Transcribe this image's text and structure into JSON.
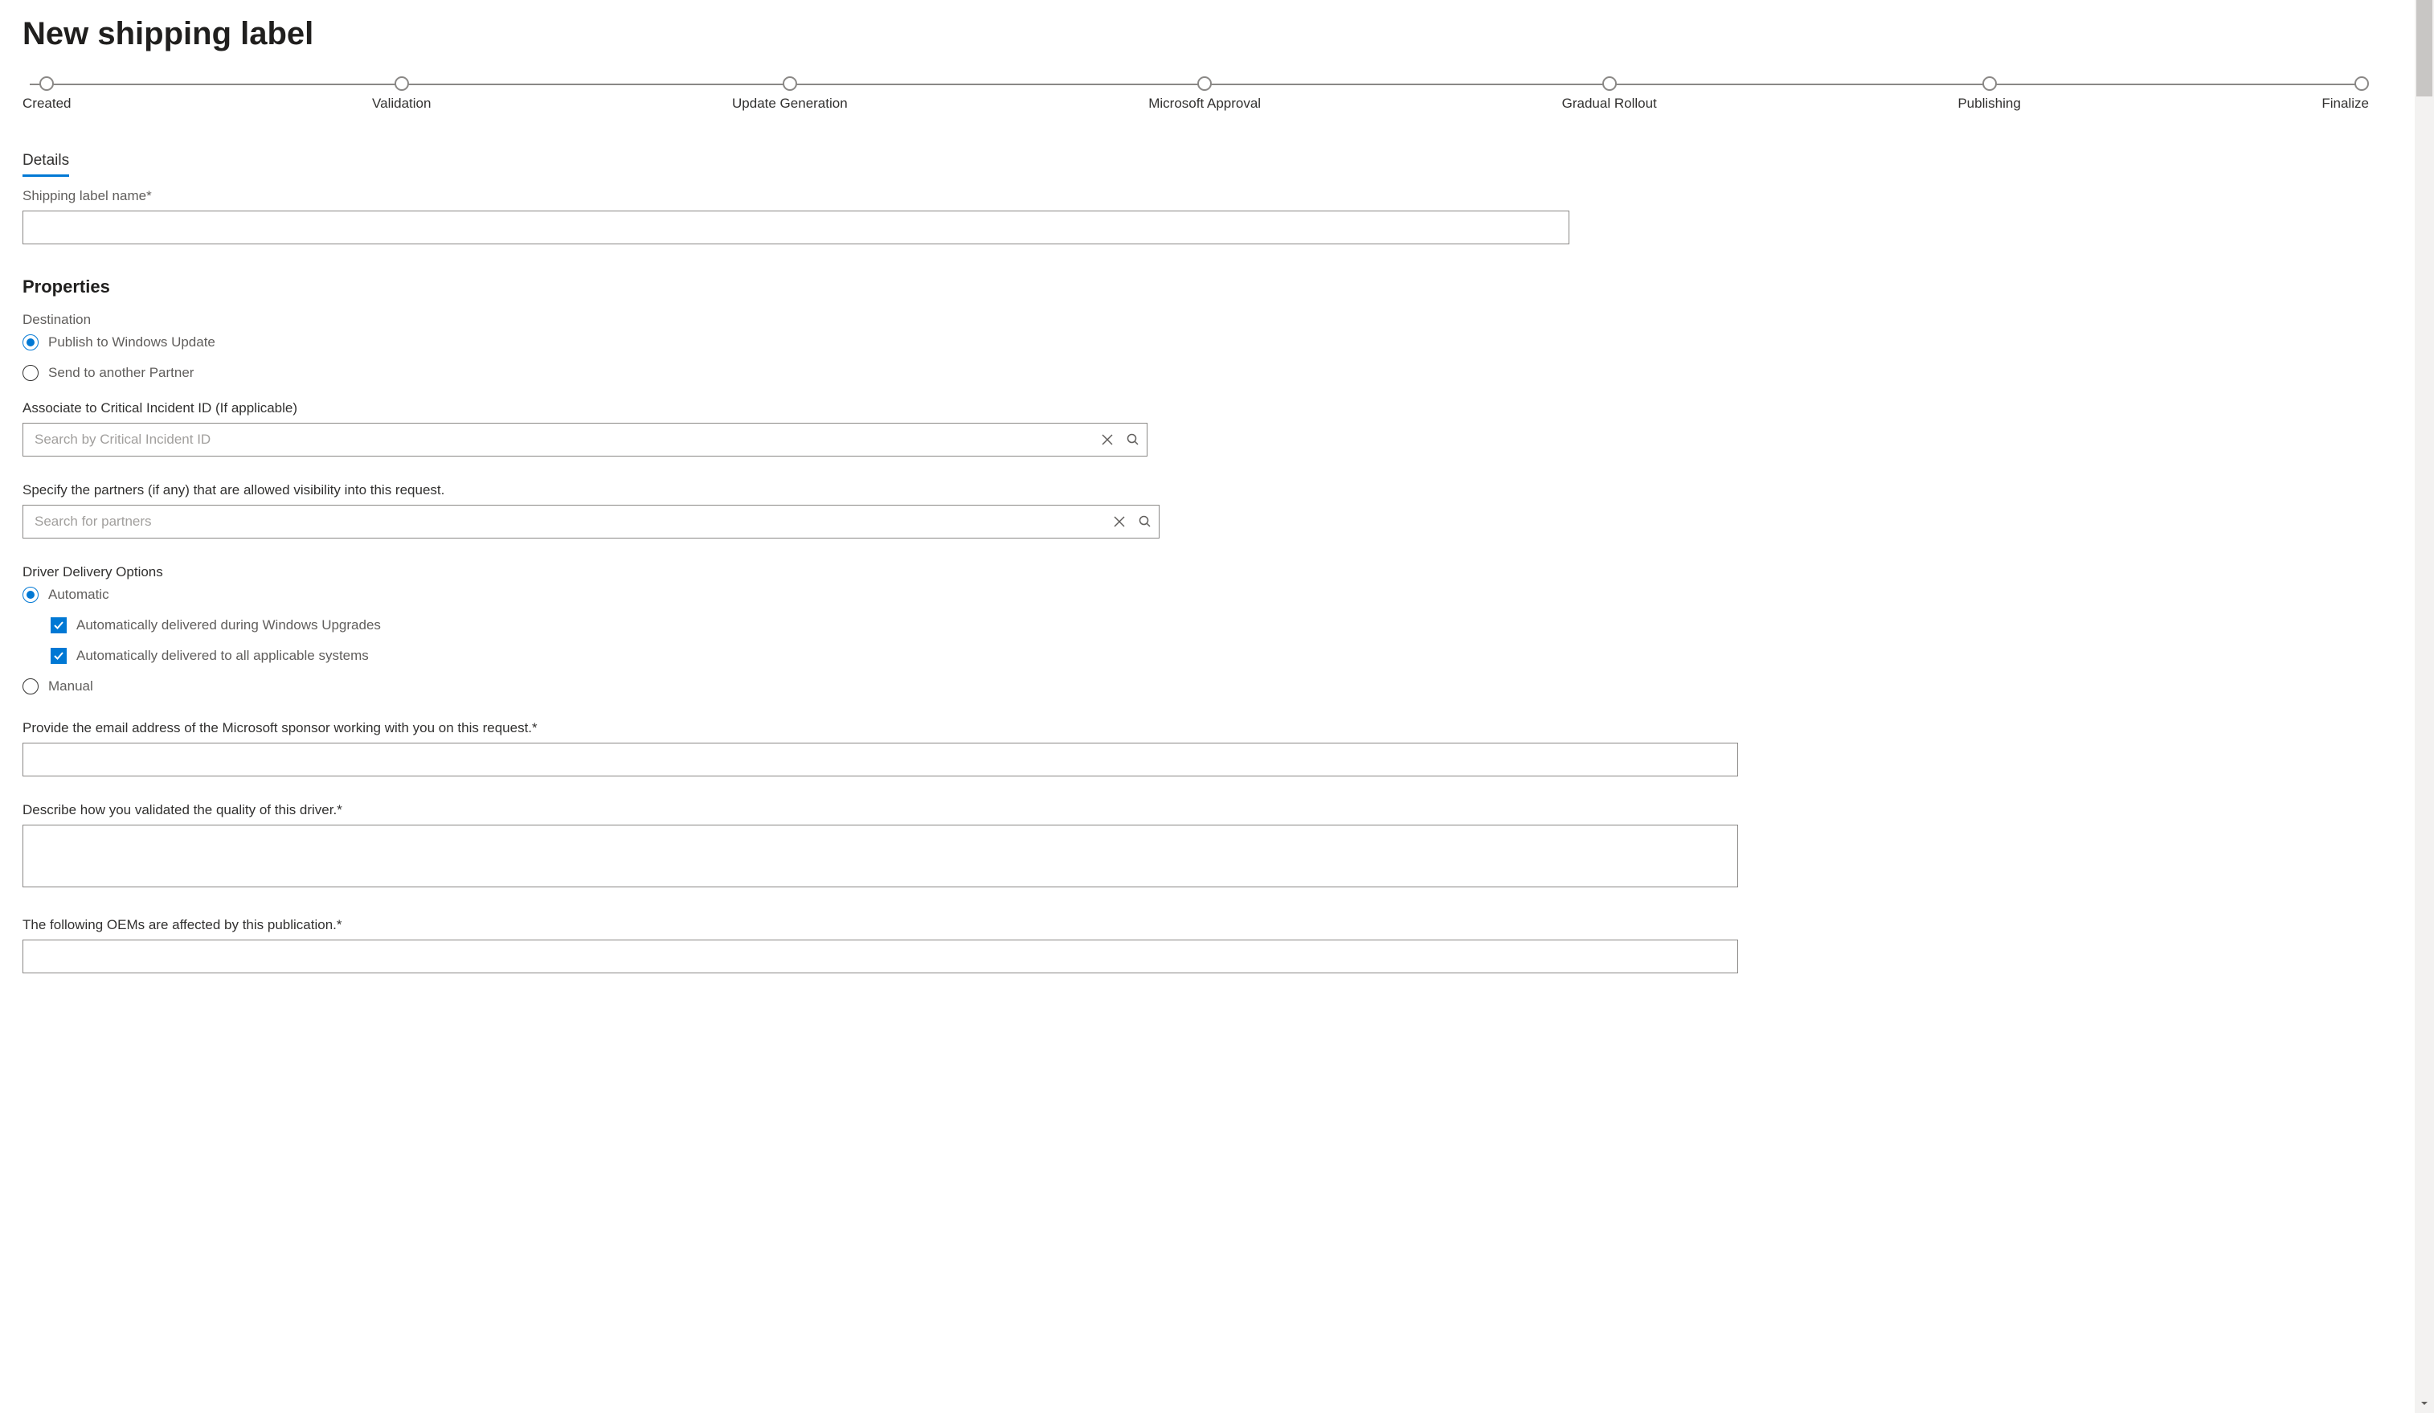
{
  "page": {
    "title": "New shipping label"
  },
  "progress": {
    "steps": [
      "Created",
      "Validation",
      "Update Generation",
      "Microsoft Approval",
      "Gradual Rollout",
      "Publishing",
      "Finalize"
    ]
  },
  "tabs": {
    "details": "Details"
  },
  "fields": {
    "shipping_label_name": "Shipping label name",
    "properties_heading": "Properties",
    "destination_label": "Destination",
    "destination_options": {
      "publish_wu": "Publish to Windows Update",
      "send_partner": "Send to another Partner"
    },
    "critical_incident_label": "Associate to Critical Incident ID (If applicable)",
    "critical_incident_placeholder": "Search by Critical Incident ID",
    "partners_label": "Specify the partners (if any) that are allowed visibility into this request.",
    "partners_placeholder": "Search for partners",
    "delivery_options_label": "Driver Delivery Options",
    "delivery_options": {
      "automatic": "Automatic",
      "auto_upgrades": "Automatically delivered during Windows Upgrades",
      "auto_all_systems": "Automatically delivered to all applicable systems",
      "manual": "Manual"
    },
    "sponsor_email_label": "Provide the email address of the Microsoft sponsor working with you on this request.",
    "validation_label": "Describe how you validated the quality of this driver.",
    "oems_label": "The following OEMs are affected by this publication."
  }
}
